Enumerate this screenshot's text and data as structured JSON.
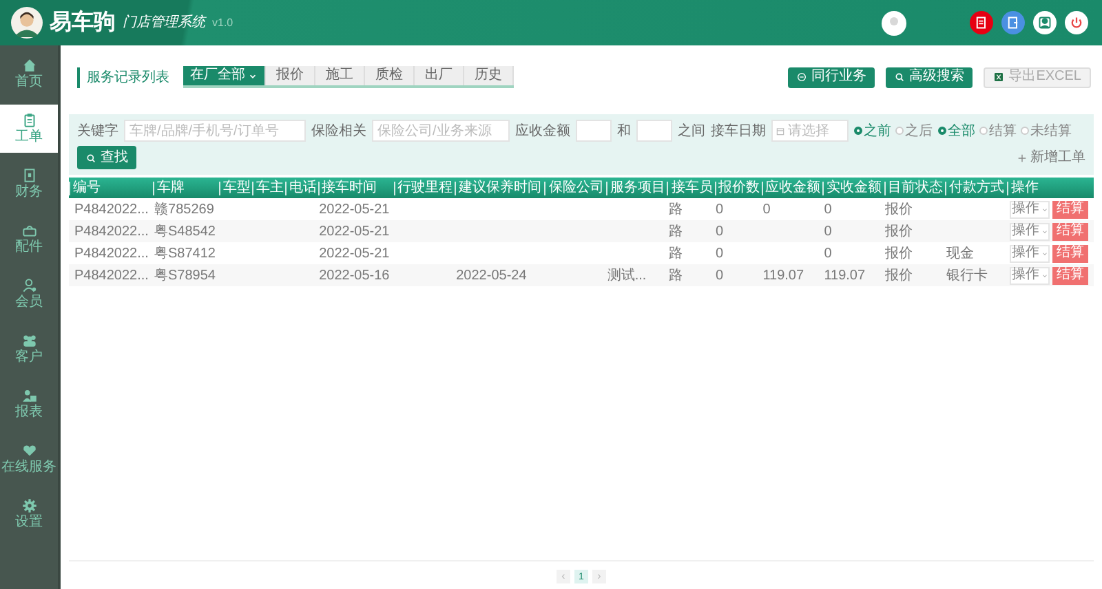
{
  "header": {
    "brand": "易车驹",
    "subtitle": "门店管理系统",
    "version": "v1.0"
  },
  "sidebar": {
    "items": [
      {
        "label": "首页",
        "selected": false
      },
      {
        "label": "工单",
        "selected": true
      },
      {
        "label": "财务",
        "selected": false
      },
      {
        "label": "配件",
        "selected": false
      },
      {
        "label": "会员",
        "selected": false
      },
      {
        "label": "客户",
        "selected": false
      },
      {
        "label": "报表",
        "selected": false
      },
      {
        "label": "在线服务",
        "selected": false
      },
      {
        "label": "设置",
        "selected": false
      }
    ]
  },
  "page_title": "服务记录列表",
  "tabs": [
    {
      "label": "在厂全部",
      "selected": true
    },
    {
      "label": "报价",
      "selected": false
    },
    {
      "label": "施工",
      "selected": false
    },
    {
      "label": "质检",
      "selected": false
    },
    {
      "label": "出厂",
      "selected": false
    },
    {
      "label": "历史",
      "selected": false
    }
  ],
  "toolbar": [
    {
      "label": "同行业务",
      "kind": "peer",
      "disabled": false
    },
    {
      "label": "高级搜索",
      "kind": "search",
      "disabled": false
    },
    {
      "label": "导出EXCEL",
      "kind": "excel",
      "disabled": true
    }
  ],
  "filters": {
    "keyword_label": "关键字",
    "keyword_placeholder": "车牌/品牌/手机号/订单号",
    "insurance_label": "保险相关",
    "insurance_placeholder": "保险公司/业务来源",
    "amount_label": "应收金额",
    "and": "和",
    "between": "之间",
    "date_label": "接车日期",
    "date_placeholder": "请选择",
    "time_options": [
      {
        "label": "之前",
        "selected": true
      },
      {
        "label": "之后",
        "selected": false
      }
    ],
    "settle_options": [
      {
        "label": "全部",
        "selected": true
      },
      {
        "label": "结算",
        "selected": false
      },
      {
        "label": "未结算",
        "selected": false
      }
    ],
    "search_button": "查找",
    "new_button": "新增工单"
  },
  "table": {
    "columns": [
      "编号",
      "车牌",
      "车型",
      "车主",
      "电话",
      "接车时间",
      "行驶里程",
      "建议保养时间",
      "保险公司",
      "服务项目",
      "接车员",
      "报价数",
      "应收金额",
      "实收金额",
      "目前状态",
      "付款方式",
      "操作"
    ],
    "rows": [
      {
        "cells": [
          "P4842022...",
          "赣785269",
          "",
          "",
          "",
          "2022-05-21",
          "",
          "",
          "",
          "",
          "路",
          "0",
          "0",
          "0",
          "报价",
          ""
        ],
        "action": "操作",
        "settle": "结算"
      },
      {
        "cells": [
          "P4842022...",
          "粤S48542",
          "",
          "",
          "",
          "2022-05-21",
          "",
          "",
          "",
          "",
          "路",
          "0",
          "",
          "0",
          "报价",
          ""
        ],
        "action": "操作",
        "settle": "结算"
      },
      {
        "cells": [
          "P4842022...",
          "粤S87412",
          "",
          "",
          "",
          "2022-05-21",
          "",
          "",
          "",
          "",
          "路",
          "0",
          "",
          "0",
          "报价",
          "现金"
        ],
        "action": "操作",
        "settle": "结算"
      },
      {
        "cells": [
          "P4842022...",
          "粤S78954",
          "",
          "",
          "",
          "2022-05-16",
          "",
          "2022-05-24",
          "",
          "测试...",
          "路",
          "0",
          "119.07",
          "119.07",
          "报价",
          "银行卡"
        ],
        "action": "操作",
        "settle": "结算"
      }
    ]
  },
  "pagination": {
    "prev": "‹",
    "next": "›",
    "pages": [
      {
        "label": "1",
        "selected": true
      }
    ]
  }
}
